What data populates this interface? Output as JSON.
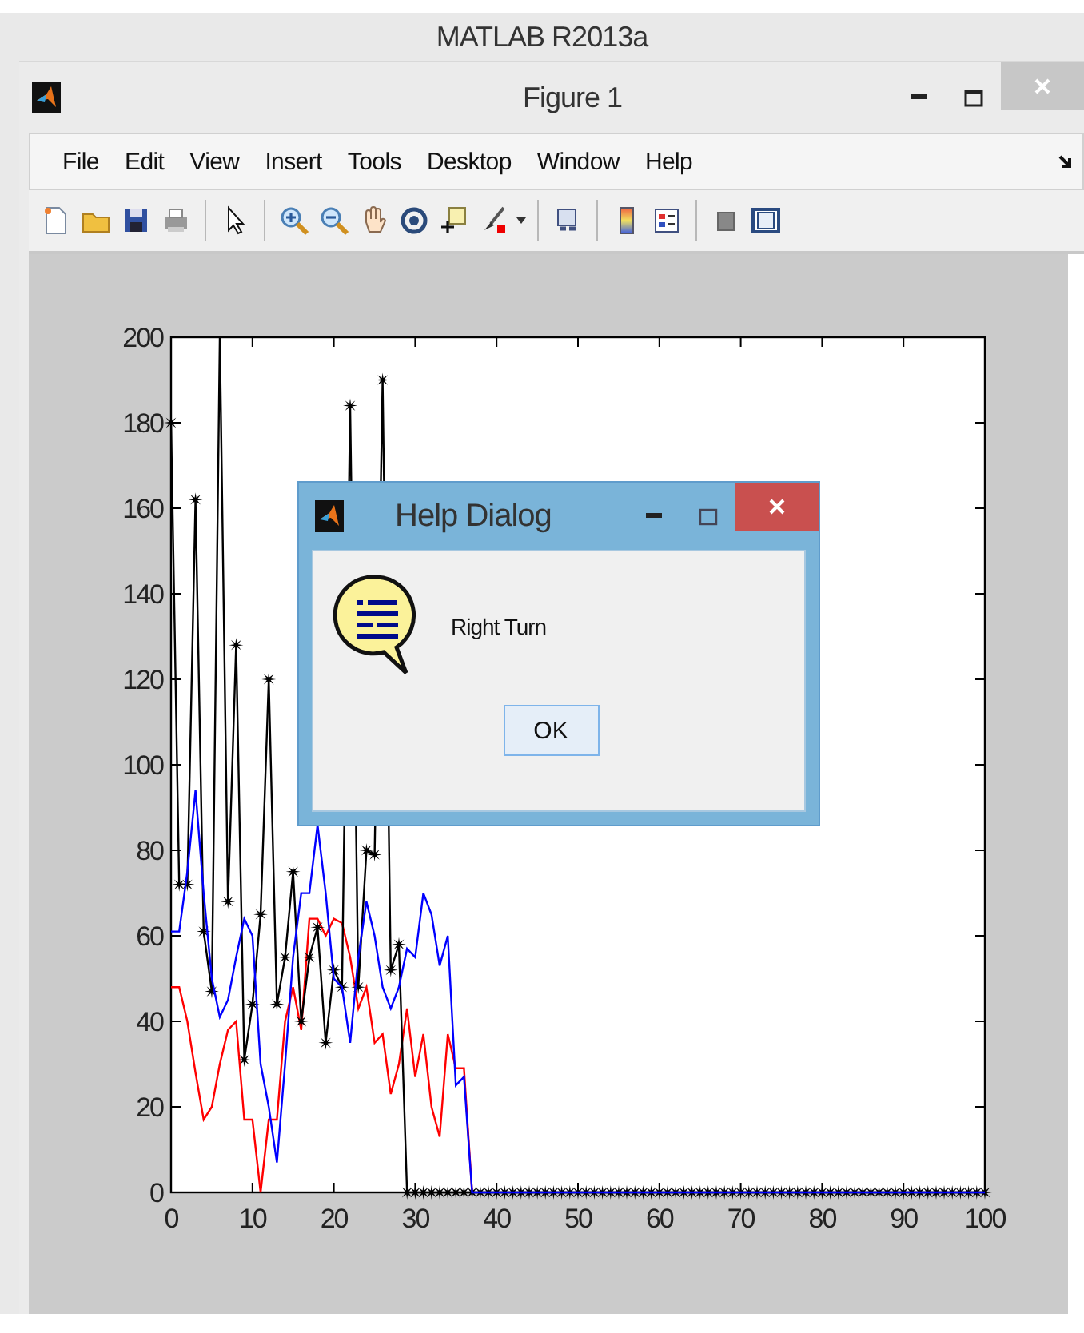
{
  "app_window": {
    "title": "MATLAB R2013a"
  },
  "figure_window": {
    "title": "Figure 1"
  },
  "menu": [
    "File",
    "Edit",
    "View",
    "Insert",
    "Tools",
    "Desktop",
    "Window",
    "Help"
  ],
  "figure": {
    "chart_data": {
      "type": "line",
      "xlim": [
        0,
        100
      ],
      "ylim": [
        0,
        200
      ],
      "xticks": [
        0,
        10,
        20,
        30,
        40,
        50,
        60,
        70,
        80,
        90,
        100
      ],
      "yticks": [
        0,
        20,
        40,
        60,
        80,
        100,
        120,
        140,
        160,
        180,
        200
      ],
      "x": [
        0,
        1,
        2,
        3,
        4,
        5,
        6,
        7,
        8,
        9,
        10,
        11,
        12,
        13,
        14,
        15,
        16,
        17,
        18,
        19,
        20,
        21,
        22,
        23,
        24,
        25,
        26,
        27,
        28,
        29,
        30,
        31,
        32,
        33,
        34,
        35,
        36,
        37,
        38,
        39,
        40,
        41,
        42,
        43,
        44,
        45,
        46,
        47,
        48,
        49,
        50,
        51,
        52,
        53,
        54,
        55,
        56,
        57,
        58,
        59,
        60,
        61,
        62,
        63,
        64,
        65,
        66,
        67,
        68,
        69,
        70,
        71,
        72,
        73,
        74,
        75,
        76,
        77,
        78,
        79,
        80,
        81,
        82,
        83,
        84,
        85,
        86,
        87,
        88,
        89,
        90,
        91,
        92,
        93,
        94,
        95,
        96,
        97,
        98,
        99,
        100
      ],
      "series": [
        {
          "color": "#000000",
          "marker": "star",
          "values": [
            180,
            72,
            72,
            162,
            61,
            47,
            200,
            68,
            128,
            31,
            44,
            65,
            120,
            44,
            55,
            75,
            40,
            55,
            62,
            35,
            52,
            48,
            184,
            48,
            80,
            79,
            190,
            52,
            58,
            0,
            0,
            0,
            0,
            0,
            0,
            0,
            0,
            0,
            0,
            0,
            0,
            0,
            0,
            0,
            0,
            0,
            0,
            0,
            0,
            0,
            0,
            0,
            0,
            0,
            0,
            0,
            0,
            0,
            0,
            0,
            0,
            0,
            0,
            0,
            0,
            0,
            0,
            0,
            0,
            0,
            0,
            0,
            0,
            0,
            0,
            0,
            0,
            0,
            0,
            0,
            0,
            0,
            0,
            0,
            0,
            0,
            0,
            0,
            0,
            0,
            0,
            0,
            0,
            0,
            0,
            0,
            0,
            0,
            0,
            0,
            0
          ]
        },
        {
          "color": "#0000ff",
          "marker": "none",
          "values": [
            61,
            61,
            75,
            94,
            70,
            50,
            41,
            45,
            55,
            64,
            60,
            30,
            20,
            7,
            30,
            55,
            70,
            70,
            86,
            70,
            50,
            48,
            35,
            55,
            68,
            60,
            48,
            43,
            48,
            57,
            55,
            70,
            65,
            53,
            60,
            25,
            27,
            0,
            0,
            0,
            0,
            0,
            0,
            0,
            0,
            0,
            0,
            0,
            0,
            0,
            0,
            0,
            0,
            0,
            0,
            0,
            0,
            0,
            0,
            0,
            0,
            0,
            0,
            0,
            0,
            0,
            0,
            0,
            0,
            0,
            0,
            0,
            0,
            0,
            0,
            0,
            0,
            0,
            0,
            0,
            0,
            0,
            0,
            0,
            0,
            0,
            0,
            0,
            0,
            0,
            0,
            0,
            0,
            0,
            0,
            0,
            0,
            0,
            0,
            0,
            0
          ]
        },
        {
          "color": "#ff0000",
          "marker": "none",
          "values": [
            48,
            48,
            40,
            28,
            17,
            20,
            30,
            38,
            40,
            17,
            17,
            0,
            17,
            17,
            40,
            48,
            38,
            64,
            64,
            60,
            64,
            63,
            55,
            43,
            48,
            35,
            37,
            23,
            30,
            43,
            27,
            37,
            20,
            13,
            37,
            29,
            29,
            0,
            null,
            null,
            null,
            null,
            null,
            null,
            null,
            null,
            null,
            null,
            null,
            null,
            null,
            null,
            null,
            null,
            null,
            null,
            null,
            null,
            null,
            null,
            null,
            null,
            null,
            null,
            null,
            null,
            null,
            null,
            null,
            null,
            null,
            null,
            null,
            null,
            null,
            null,
            null,
            null,
            null,
            null,
            null,
            null,
            null,
            null,
            null,
            null,
            null,
            null,
            null,
            null,
            null,
            null,
            null,
            null,
            null,
            null,
            null,
            null,
            null,
            null,
            null
          ]
        }
      ]
    }
  },
  "dialog": {
    "title": "Help Dialog",
    "message": "Right Turn",
    "button": "OK"
  }
}
